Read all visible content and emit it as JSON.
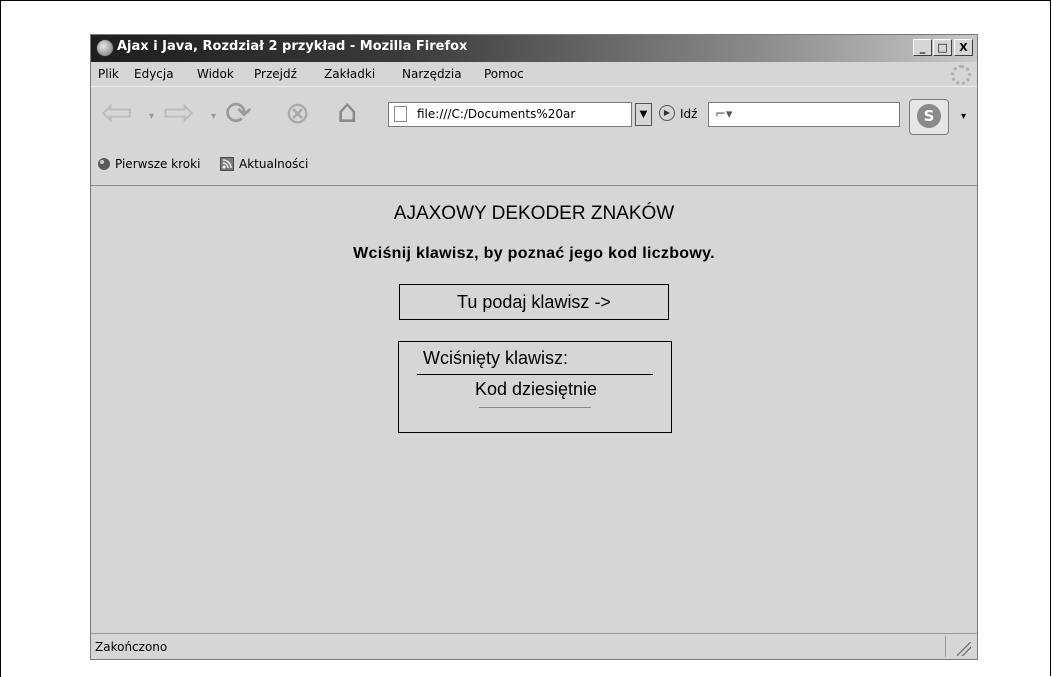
{
  "window": {
    "title": "Ajax i Java, Rozdział 2 przykład - Mozilla Firefox",
    "minimize": "_",
    "maximize": "□",
    "close": "X"
  },
  "menu": {
    "items": [
      "Plik",
      "Edycja",
      "Widok",
      "Przejdź",
      "Zakładki",
      "Narzędzia",
      "Pomoc"
    ]
  },
  "nav": {
    "url": "file:///C:/Documents%20ar",
    "go_label": "Idź",
    "dropdown_glyph": "▼"
  },
  "bookmarks": {
    "items": [
      "Pierwsze kroki",
      "Aktualności"
    ]
  },
  "page": {
    "title": "AJAXOWY DEKODER ZNAKÓW",
    "instruction": "Wciśnij klawisz, by poznać jego kod liczbowy.",
    "input_text": "Tu podaj klawisz ->",
    "pressed_label": "Wciśnięty klawisz:",
    "decimal_label": "Kod dziesiętnie"
  },
  "status": {
    "text": "Zakończono"
  }
}
